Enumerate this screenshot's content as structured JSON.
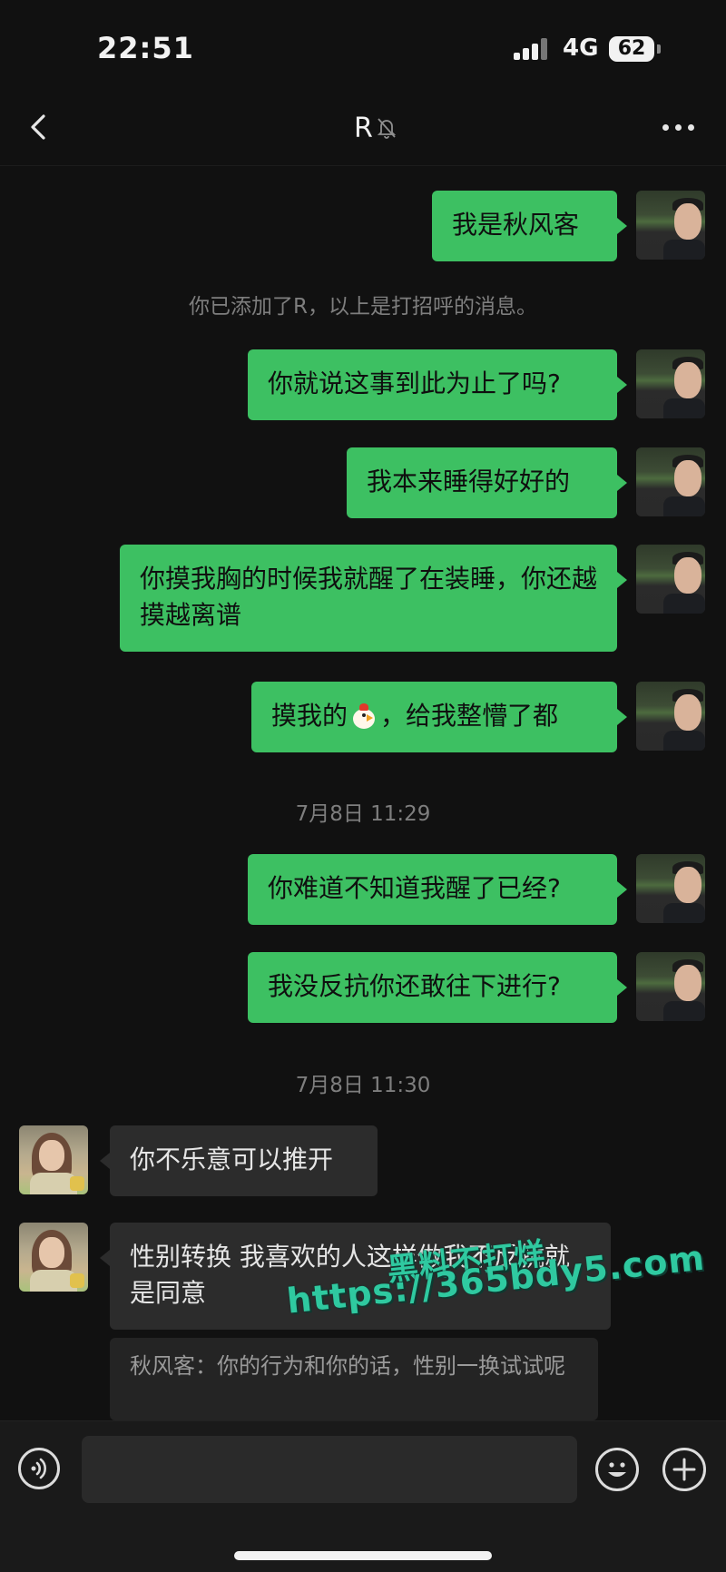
{
  "status_bar": {
    "time": "22:51",
    "network": "4G",
    "battery": "62"
  },
  "header": {
    "title": "R",
    "muted_icon": "bell-slash-icon",
    "more_icon": "ellipsis-icon",
    "back_icon": "chevron-left-icon"
  },
  "messages": [
    {
      "text": "我是秋风客"
    },
    {
      "text": "你已添加了R，以上是打招呼的消息。"
    },
    {
      "text": "你就说这事到此为止了吗?"
    },
    {
      "text": "我本来睡得好好的"
    },
    {
      "text": "你摸我胸的时候我就醒了在装睡，你还越摸越离谱"
    },
    {
      "text_before": "摸我的",
      "emoji": "chicken-emoji",
      "text_after": "，给我整懵了都"
    },
    {
      "text": "7月8日 11:29"
    },
    {
      "text": "你难道不知道我醒了已经?"
    },
    {
      "text": "我没反抗你还敢往下进行?"
    },
    {
      "text": "7月8日 11:30"
    },
    {
      "text": "你不乐意可以推开"
    },
    {
      "text": "性别转换 我喜欢的人这样做我不反抗就是同意"
    },
    {
      "text": "秋风客：你的行为和你的话，性别一换试试呢"
    }
  ],
  "watermark": {
    "line1": "黑料不打烊",
    "line2": "https://365bdy5.com"
  },
  "input_bar": {
    "voice_icon": "voice-icon",
    "emoji_icon": "smile-icon",
    "plus_icon": "plus-icon",
    "value": ""
  },
  "colors": {
    "background": "#111111",
    "outgoing_bubble": "#3dc062",
    "incoming_bubble": "#2c2c2c",
    "watermark": "#2fc9a0"
  }
}
